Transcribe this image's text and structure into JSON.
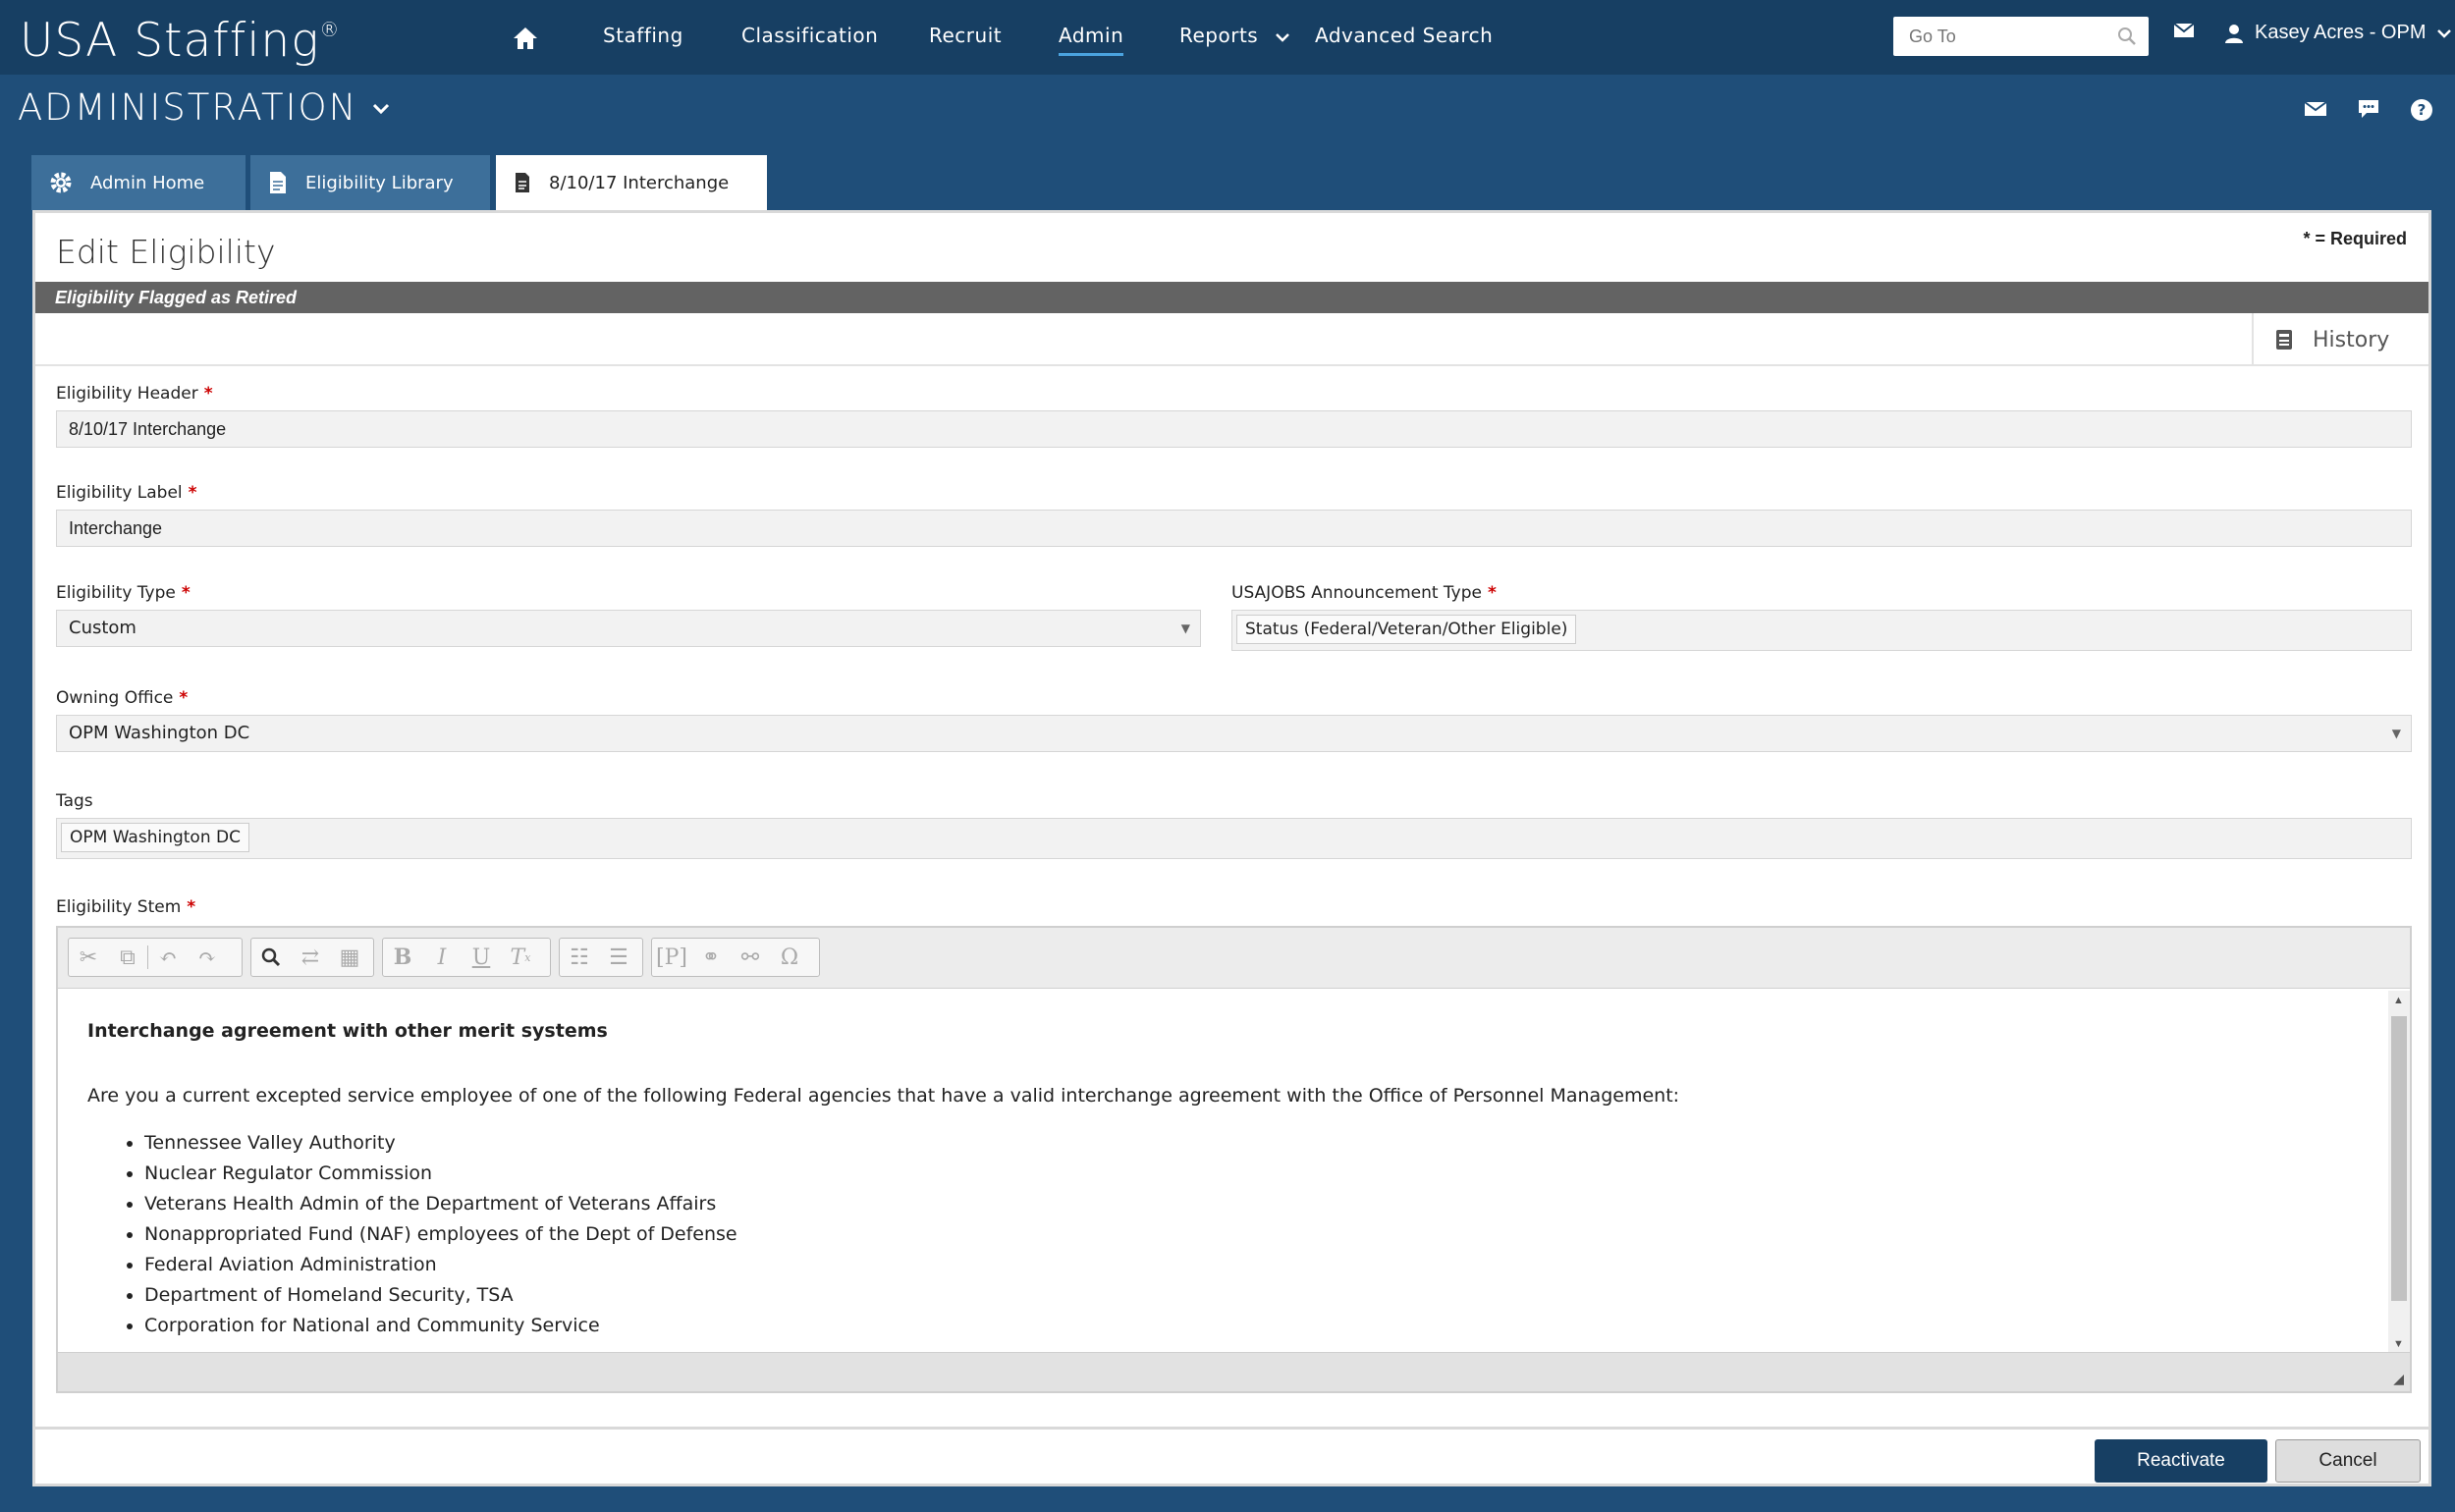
{
  "app": {
    "brand": "USA Staffing",
    "brand_mark": "®"
  },
  "nav": {
    "items": [
      {
        "label": "Staffing"
      },
      {
        "label": "Classification"
      },
      {
        "label": "Recruit"
      },
      {
        "label": "Admin",
        "active": true
      },
      {
        "label": "Reports"
      },
      {
        "label": "Advanced Search"
      }
    ],
    "goto_placeholder": "Go To",
    "user": "Kasey Acres - OPM"
  },
  "section": {
    "title": "ADMINISTRATION"
  },
  "tabs": [
    {
      "label": "Admin Home",
      "icon": "gear-icon"
    },
    {
      "label": "Eligibility Library",
      "icon": "document-icon"
    },
    {
      "label": "8/10/17 Interchange",
      "icon": "document-icon",
      "active": true
    }
  ],
  "form": {
    "title": "Edit Eligibility",
    "required_note": "* = Required",
    "retired_banner": "Eligibility Flagged as Retired",
    "history_label": "History",
    "header_label": "Eligibility Header",
    "header_value": "8/10/17 Interchange",
    "label_label": "Eligibility Label",
    "label_value": "Interchange",
    "type_label": "Eligibility Type",
    "type_value": "Custom",
    "usajobs_label": "USAJOBS Announcement Type",
    "usajobs_value": "Status (Federal/Veteran/Other Eligible)",
    "office_label": "Owning Office",
    "office_value": "OPM Washington DC",
    "tags_label": "Tags",
    "tags_value": "OPM Washington DC",
    "stem_label": "Eligibility Stem",
    "required_mark": "*"
  },
  "editor": {
    "heading": "Interchange agreement with other merit systems",
    "question": "Are you a current excepted service employee of one of the following Federal agencies that have a valid interchange agreement with the Office of Personnel Management:",
    "agencies": [
      "Tennessee Valley Authority",
      "Nuclear Regulator Commission",
      "Veterans Health Admin of the Department of Veterans Affairs",
      "Nonappropriated Fund (NAF) employees of the Dept of Defense",
      "Federal Aviation Administration",
      "Department of Homeland Security, TSA",
      "Corporation for National and Community Service"
    ]
  },
  "actions": {
    "primary": "Reactivate",
    "secondary": "Cancel"
  },
  "colors": {
    "nav_bg": "#173f63",
    "page_bg": "#1f4e79",
    "tab_bg": "#3d6f9a",
    "retired_bar": "#636363",
    "primary_btn": "#173f63",
    "required": "#cc0000"
  }
}
